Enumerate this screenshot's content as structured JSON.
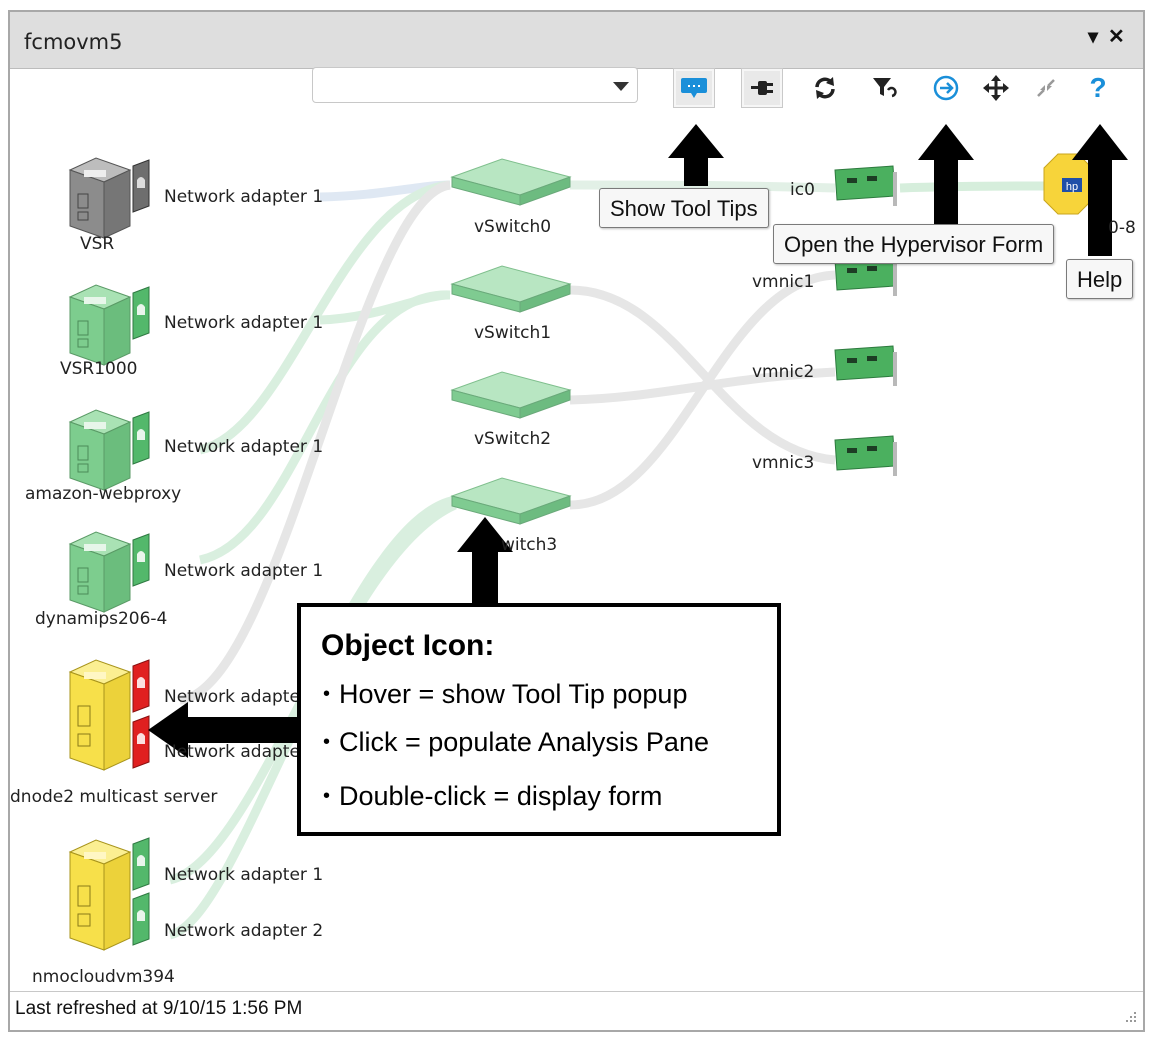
{
  "window": {
    "title": "fcmovm5",
    "menu_glyph": "▾",
    "close_glyph": "✕"
  },
  "toolbar": {
    "combo_value": "",
    "buttons": [
      {
        "name": "show-tool-tips-button",
        "icon": "speech-bubble-icon",
        "pressed": true
      },
      {
        "name": "show-adapters-button",
        "icon": "plug-icon",
        "pressed": true
      },
      {
        "name": "refresh-button",
        "icon": "refresh-icon",
        "pressed": false
      },
      {
        "name": "filter-reset-button",
        "icon": "filter-icon",
        "pressed": false
      },
      {
        "name": "open-hypervisor-form-button",
        "icon": "open-form-icon",
        "pressed": false
      },
      {
        "name": "move-button",
        "icon": "move-icon",
        "pressed": false
      },
      {
        "name": "collapse-button",
        "icon": "collapse-icon",
        "pressed": false
      },
      {
        "name": "help-button",
        "icon": "question-icon",
        "pressed": false
      }
    ]
  },
  "vms": [
    {
      "name": "VSR",
      "color": "gray",
      "adapters": [
        "Network adapter 1"
      ]
    },
    {
      "name": "VSR1000",
      "color": "green",
      "adapters": [
        "Network adapter 1"
      ]
    },
    {
      "name": "amazon-webproxy",
      "color": "green",
      "adapters": [
        "Network adapter 1"
      ]
    },
    {
      "name": "dynamips206-4",
      "color": "green",
      "adapters": [
        "Network adapter 1"
      ]
    },
    {
      "name": "dnode2 multicast server",
      "color": "yellow",
      "adapters": [
        "Network adapte",
        "Network adapte"
      ]
    },
    {
      "name": "nmocloudvm394",
      "color": "yellow",
      "adapters": [
        "Network adapter 1",
        "Network adapter 2"
      ]
    }
  ],
  "switches": [
    "vSwitch0",
    "vSwitch1",
    "vSwitch2",
    "witch3"
  ],
  "nics": [
    "ic0",
    "vmnic1",
    "vmnic2",
    "vmnic3"
  ],
  "host_label": "0-8",
  "tooltips": {
    "show_tool_tips": "Show Tool Tips",
    "open_hypervisor_form": "Open the Hypervisor Form",
    "help": "Help"
  },
  "callout": {
    "title": "Object Icon:",
    "items": [
      "Hover = show Tool Tip popup",
      "Click = populate Analysis Pane",
      "Double-click = display form"
    ]
  },
  "status": {
    "last_refreshed": "Last refreshed at 9/10/15 1:56 PM"
  },
  "colors": {
    "vm_gray": "#8c8c8c",
    "vm_green": "#7dcd8e",
    "vm_yellow": "#f7e04a",
    "adapter_red": "#e02020",
    "switch_green": "#92d6a0",
    "link_green": "#d9efdf",
    "link_gray": "#e6e6e6",
    "accent_blue": "#1a8fd9"
  }
}
